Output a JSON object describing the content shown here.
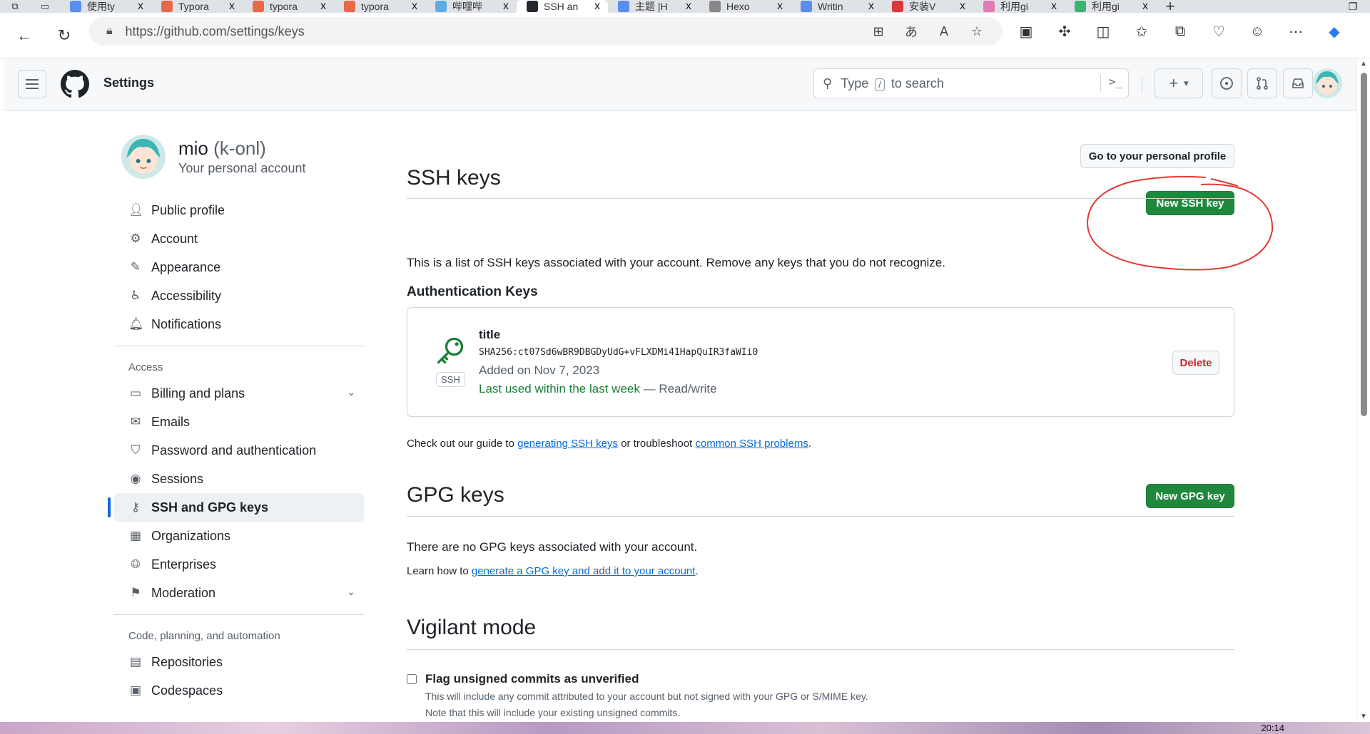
{
  "browser": {
    "tabs": [
      {
        "title": "使用ty",
        "color": "#5b8def",
        "active": false
      },
      {
        "title": "Typora",
        "color": "#e8684a",
        "active": false
      },
      {
        "title": "typora",
        "color": "#e8684a",
        "active": false
      },
      {
        "title": "typora",
        "color": "#e8684a",
        "active": false
      },
      {
        "title": "哔哩哔",
        "color": "#5aaee5",
        "active": false
      },
      {
        "title": "SSH an",
        "color": "#24292f",
        "active": true
      },
      {
        "title": "主题 |H",
        "color": "#5b8def",
        "active": false
      },
      {
        "title": "Hexo",
        "color": "#888888",
        "active": false
      },
      {
        "title": "Writin",
        "color": "#5b8def",
        "active": false
      },
      {
        "title": "安装V",
        "color": "#d9363e",
        "active": false
      },
      {
        "title": "利用gi",
        "color": "#e07bb5",
        "active": false
      },
      {
        "title": "利用gi",
        "color": "#3cb371",
        "active": false
      }
    ],
    "close_glyph": "x",
    "new_tab_glyph": "+",
    "url": "https://github.com/settings/keys"
  },
  "header": {
    "title": "Settings",
    "search_prefix": "Type",
    "search_key": "/",
    "search_suffix": "to search",
    "command_glyph": ">_",
    "plus_glyph": "+",
    "caret_glyph": "▾"
  },
  "user": {
    "name": "mio",
    "login": "(k-onl)",
    "subtitle": "Your personal account",
    "profile_button": "Go to your personal profile"
  },
  "sidebar": {
    "top_items": [
      {
        "label": "Public profile",
        "icon": "person-icon"
      },
      {
        "label": "Account",
        "icon": "gear-icon"
      },
      {
        "label": "Appearance",
        "icon": "paintbrush-icon"
      },
      {
        "label": "Accessibility",
        "icon": "accessibility-icon"
      },
      {
        "label": "Notifications",
        "icon": "bell-icon"
      }
    ],
    "access_heading": "Access",
    "access_items": [
      {
        "label": "Billing and plans",
        "icon": "credit-card-icon",
        "expandable": true
      },
      {
        "label": "Emails",
        "icon": "mail-icon"
      },
      {
        "label": "Password and authentication",
        "icon": "shield-icon"
      },
      {
        "label": "Sessions",
        "icon": "broadcast-icon"
      },
      {
        "label": "SSH and GPG keys",
        "icon": "key-icon",
        "active": true
      },
      {
        "label": "Organizations",
        "icon": "organization-icon"
      },
      {
        "label": "Enterprises",
        "icon": "globe-icon"
      },
      {
        "label": "Moderation",
        "icon": "report-icon",
        "expandable": true
      }
    ],
    "code_heading": "Code, planning, and automation",
    "code_items": [
      {
        "label": "Repositories",
        "icon": "repo-icon"
      },
      {
        "label": "Codespaces",
        "icon": "codespaces-icon"
      }
    ]
  },
  "ssh": {
    "title": "SSH keys",
    "new_button": "New SSH key",
    "description": "This is a list of SSH keys associated with your account. Remove any keys that you do not recognize.",
    "auth_heading": "Authentication Keys",
    "key": {
      "title": "title",
      "fingerprint": "SHA256:ct07Sd6wBR9DBGDyUdG+vFLXDMi41HapQuIR3faWIi0",
      "added": "Added on Nov 7, 2023",
      "last_used": "Last used within the last week",
      "dash": " — ",
      "access": "Read/write",
      "badge": "SSH",
      "delete_button": "Delete"
    },
    "guide_prefix": "Check out our guide to ",
    "guide_link1": "generating SSH keys",
    "guide_mid": " or troubleshoot ",
    "guide_link2": "common SSH problems",
    "guide_suffix": "."
  },
  "gpg": {
    "title": "GPG keys",
    "new_button": "New GPG key",
    "empty": "There are no GPG keys associated with your account.",
    "learn_prefix": "Learn how to ",
    "learn_link": "generate a GPG key and add it to your account",
    "learn_suffix": "."
  },
  "vigilant": {
    "title": "Vigilant mode",
    "checkbox_label": "Flag unsigned commits as unverified",
    "checked": false,
    "note1": "This will include any commit attributed to your account but not signed with your GPG or S/MIME key.",
    "note2": "Note that this will include your existing unsigned commits."
  },
  "taskbar": {
    "clock": "20:14"
  },
  "colors": {
    "accent": "#0969da",
    "green": "#1f883d",
    "danger": "#cf222e",
    "annotation": "#e53935"
  }
}
